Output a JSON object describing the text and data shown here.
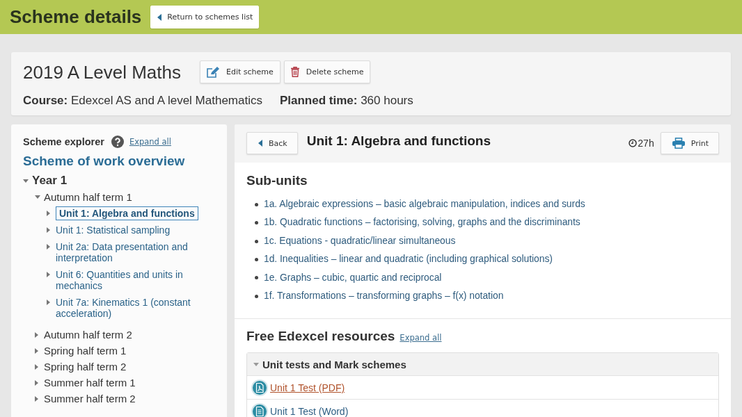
{
  "header": {
    "title": "Scheme details",
    "return_button": "Return to schemes list"
  },
  "scheme": {
    "title": "2019 A Level Maths",
    "buttons": [
      {
        "label": "Edit scheme",
        "kind": "edit"
      },
      {
        "label": "Delete scheme",
        "kind": "delete"
      }
    ],
    "course": "**Course:** Edexcel AS and A level Mathematics",
    "planned_time": "**Planned time:** 360 hours"
  },
  "explorer": {
    "title": "Scheme explorer",
    "expand_all": "Expand all",
    "overview": "Scheme of work overview",
    "tree": [
      {
        "label": "Year 1",
        "expanded": true,
        "selected": false,
        "children": [
          {
            "label": "Autumn half term 1",
            "expanded": true,
            "selected": false,
            "children": [
              {
                "label": "Unit 1: Algebra and functions",
                "expanded": false,
                "selected": true
              },
              {
                "label": "Unit 1: Statistical sampling",
                "expanded": false,
                "selected": false
              },
              {
                "label": "Unit 2a: Data presentation and interpretation",
                "expanded": false,
                "selected": false
              },
              {
                "label": "Unit 6: Quantities and units in mechanics",
                "expanded": false,
                "selected": false
              },
              {
                "label": "Unit 7a: Kinematics 1 (constant acceleration)",
                "expanded": false,
                "selected": false
              }
            ]
          },
          {
            "label": "Autumn half term 2",
            "expanded": false,
            "selected": false
          },
          {
            "label": "Spring half term 1",
            "expanded": false,
            "selected": false
          },
          {
            "label": "Spring half term 2",
            "expanded": false,
            "selected": false
          },
          {
            "label": "Summer half term 1",
            "expanded": false,
            "selected": false
          },
          {
            "label": "Summer half term 2",
            "expanded": false,
            "selected": false
          }
        ]
      }
    ]
  },
  "unit": {
    "back_button": "Back",
    "title": "Unit 1: Algebra and functions",
    "duration": "27h",
    "print_button": "Print",
    "subunits_title": "Sub-units",
    "subunits": [
      "1a. Algebraic expressions – basic algebraic manipulation, indices and surds",
      "1b. Quadratic functions – factorising, solving, graphs and the discriminants",
      "1c. Equations - quadratic/linear simultaneous",
      "1d. Inequalities – linear and quadratic (including graphical solutions)",
      "1e. Graphs – cubic, quartic and reciprocal",
      "1f. Transformations – transforming graphs – f(x) notation"
    ],
    "resources": {
      "title": "Free Edexcel resources",
      "expand_all": "Expand all",
      "groups": [
        {
          "title": "Unit tests and Mark schemes",
          "expanded": true,
          "items": [
            {
              "label": "Unit 1 Test (PDF)",
              "kind": "pdf",
              "highlighted": true
            },
            {
              "label": "Unit 1 Test (Word)",
              "kind": "word",
              "highlighted": false
            }
          ]
        }
      ]
    }
  }
}
